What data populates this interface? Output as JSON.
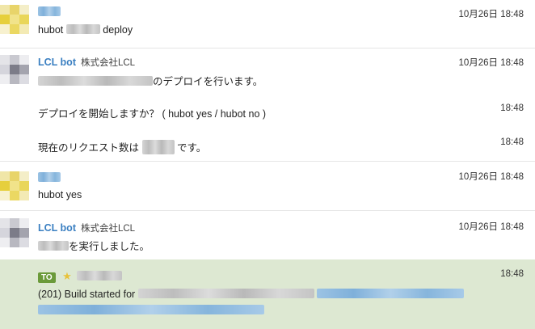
{
  "messages": [
    {
      "time": "10月26日 18:48",
      "text_prefix": "hubot",
      "text_suffix": "deploy"
    },
    {
      "sender": "LCL bot",
      "org": "株式会社LCL",
      "time": "10月26日 18:48",
      "text": "のデプロイを行います。"
    },
    {
      "time": "18:48",
      "text": "デプロイを開始しますか？ ( hubot yes / hubot no )"
    },
    {
      "time": "18:48",
      "text_prefix": "現在のリクエスト数は",
      "text_suffix": "です。"
    },
    {
      "time": "10月26日 18:48",
      "text": "hubot yes"
    },
    {
      "sender": "LCL bot",
      "org": "株式会社LCL",
      "time": "10月26日 18:48",
      "text": "を実行しました。"
    },
    {
      "to_label": "TO",
      "time": "18:48",
      "text_prefix": "(201) Build started for"
    }
  ],
  "colors": {
    "highlight_bg": "#dde8d2",
    "sender_blue": "#3a7fc1",
    "to_badge": "#6b9a3a"
  }
}
